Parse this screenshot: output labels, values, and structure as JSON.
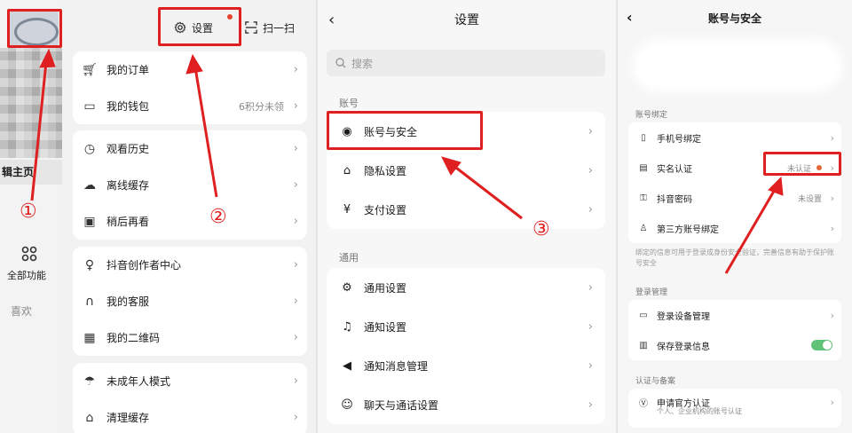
{
  "panel1": {
    "edit_home": "辑主页",
    "all_functions": "全部功能",
    "likes": "喜欢",
    "icons": {
      "all_functions": "grid-icon"
    }
  },
  "panel2": {
    "settings_label": "设置",
    "scan_label": "扫一扫",
    "groups": [
      [
        {
          "label": "我的订单",
          "icon": "cart-icon"
        },
        {
          "label": "我的钱包",
          "icon": "wallet-icon",
          "sub": "6积分未领"
        }
      ],
      [
        {
          "label": "观看历史",
          "icon": "clock-icon"
        },
        {
          "label": "离线缓存",
          "icon": "download-cloud-icon"
        },
        {
          "label": "稍后再看",
          "icon": "watch-later-icon"
        }
      ],
      [
        {
          "label": "抖音创作者中心",
          "icon": "bulb-icon"
        },
        {
          "label": "我的客服",
          "icon": "headset-icon"
        },
        {
          "label": "我的二维码",
          "icon": "qrcode-icon"
        }
      ],
      [
        {
          "label": "未成年人模式",
          "icon": "umbrella-icon"
        },
        {
          "label": "清理缓存",
          "icon": "broom-icon"
        }
      ]
    ]
  },
  "panel3": {
    "title": "设置",
    "search_placeholder": "搜索",
    "section_account": "账号",
    "account_items": [
      {
        "label": "账号与安全",
        "icon": "user-circle-icon"
      },
      {
        "label": "隐私设置",
        "icon": "lock-icon"
      },
      {
        "label": "支付设置",
        "icon": "yen-icon"
      }
    ],
    "section_general": "通用",
    "general_items": [
      {
        "label": "通用设置",
        "icon": "gear-icon"
      },
      {
        "label": "通知设置",
        "icon": "bell-icon"
      },
      {
        "label": "通知消息管理",
        "icon": "megaphone-icon"
      },
      {
        "label": "聊天与通话设置",
        "icon": "chat-icon"
      }
    ]
  },
  "panel4": {
    "title": "账号与安全",
    "section_binding": "账号绑定",
    "binding_items": [
      {
        "label": "手机号绑定",
        "icon": "phone-icon"
      },
      {
        "label": "实名认证",
        "icon": "id-card-icon",
        "sub": "未认证"
      },
      {
        "label": "抖音密码",
        "icon": "key-icon",
        "sub": "未设置"
      },
      {
        "label": "第三方账号绑定",
        "icon": "user-link-icon"
      }
    ],
    "note": "绑定的信息可用于登录成身份安全验证，完善信息有助于保护账号安全",
    "section_login": "登录管理",
    "login_items": [
      {
        "label": "登录设备管理",
        "icon": "devices-icon"
      },
      {
        "label": "保存登录信息",
        "icon": "save-icon",
        "toggle_on": true
      }
    ],
    "section_cert": "认证与备案",
    "cert_item": {
      "label": "申请官方认证",
      "icon": "verified-icon",
      "sub": "个人、企业机构的账号认证"
    }
  },
  "annotations": {
    "step1": "①",
    "step2": "②",
    "step3": "③",
    "color": "#e02020"
  }
}
